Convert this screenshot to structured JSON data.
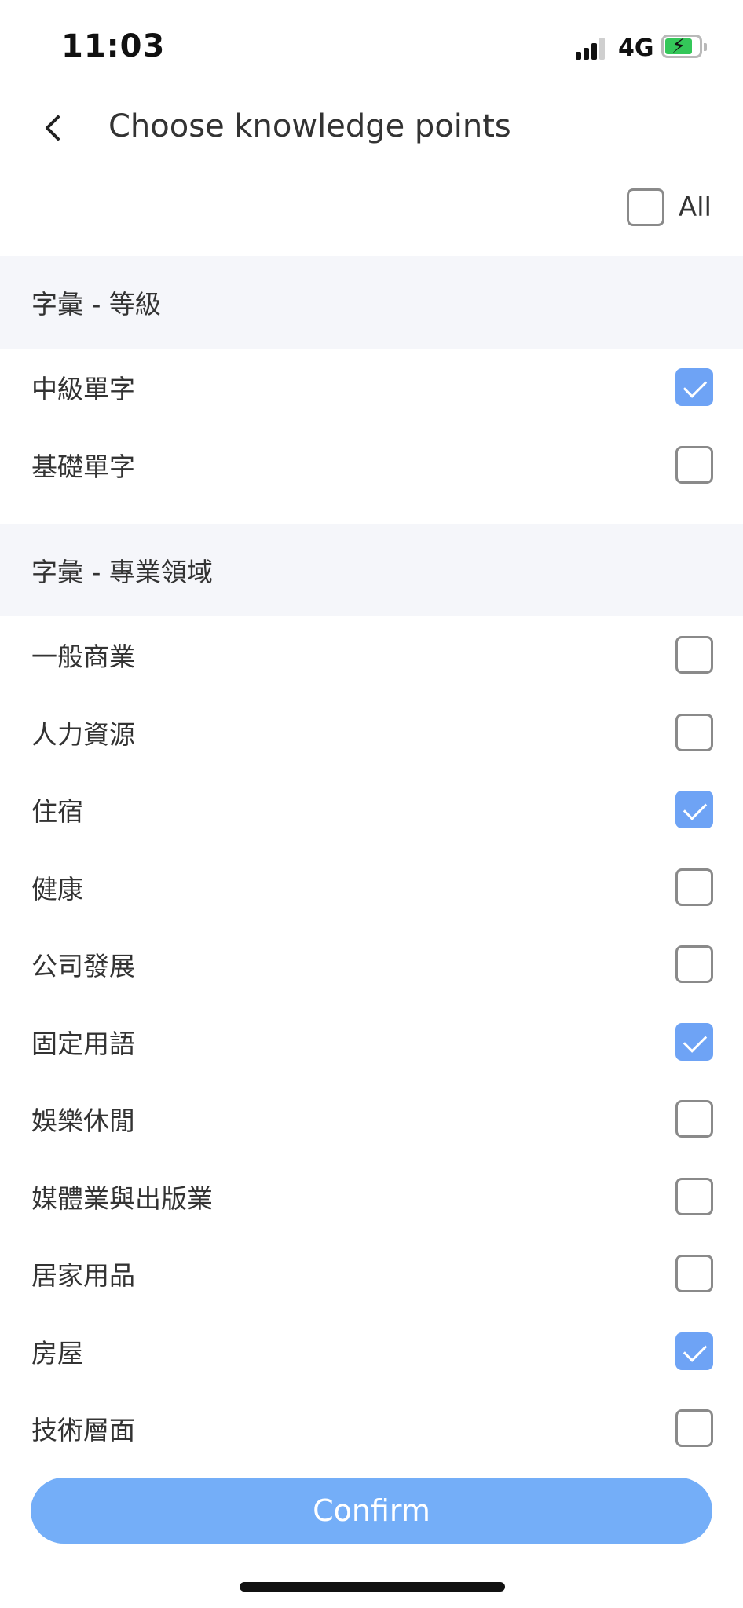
{
  "status_bar": {
    "time": "11:03",
    "network": "4G",
    "icons": [
      "signal-icon",
      "battery-charging-icon"
    ]
  },
  "header": {
    "title": "Choose knowledge points",
    "back_icon": "chevron-left-icon"
  },
  "select_all": {
    "label": "All",
    "checked": false
  },
  "sections": [
    {
      "title": "字彙 - 等級",
      "items": [
        {
          "label": "中級單字",
          "checked": true
        },
        {
          "label": "基礎單字",
          "checked": false
        }
      ]
    },
    {
      "title": "字彙 - 專業領域",
      "items": [
        {
          "label": "一般商業",
          "checked": false
        },
        {
          "label": "人力資源",
          "checked": false
        },
        {
          "label": "住宿",
          "checked": true
        },
        {
          "label": "健康",
          "checked": false
        },
        {
          "label": "公司發展",
          "checked": false
        },
        {
          "label": "固定用語",
          "checked": true
        },
        {
          "label": "娛樂休閒",
          "checked": false
        },
        {
          "label": "媒體業與出版業",
          "checked": false
        },
        {
          "label": "居家用品",
          "checked": false
        },
        {
          "label": "房屋",
          "checked": true
        },
        {
          "label": "技術層面",
          "checked": false
        }
      ]
    }
  ],
  "confirm": {
    "label": "Confirm"
  },
  "colors": {
    "accent": "#6ea3f5",
    "button": "#74aef8",
    "section_bg": "#f5f6fa",
    "checkbox_border": "#8a8a8a"
  }
}
